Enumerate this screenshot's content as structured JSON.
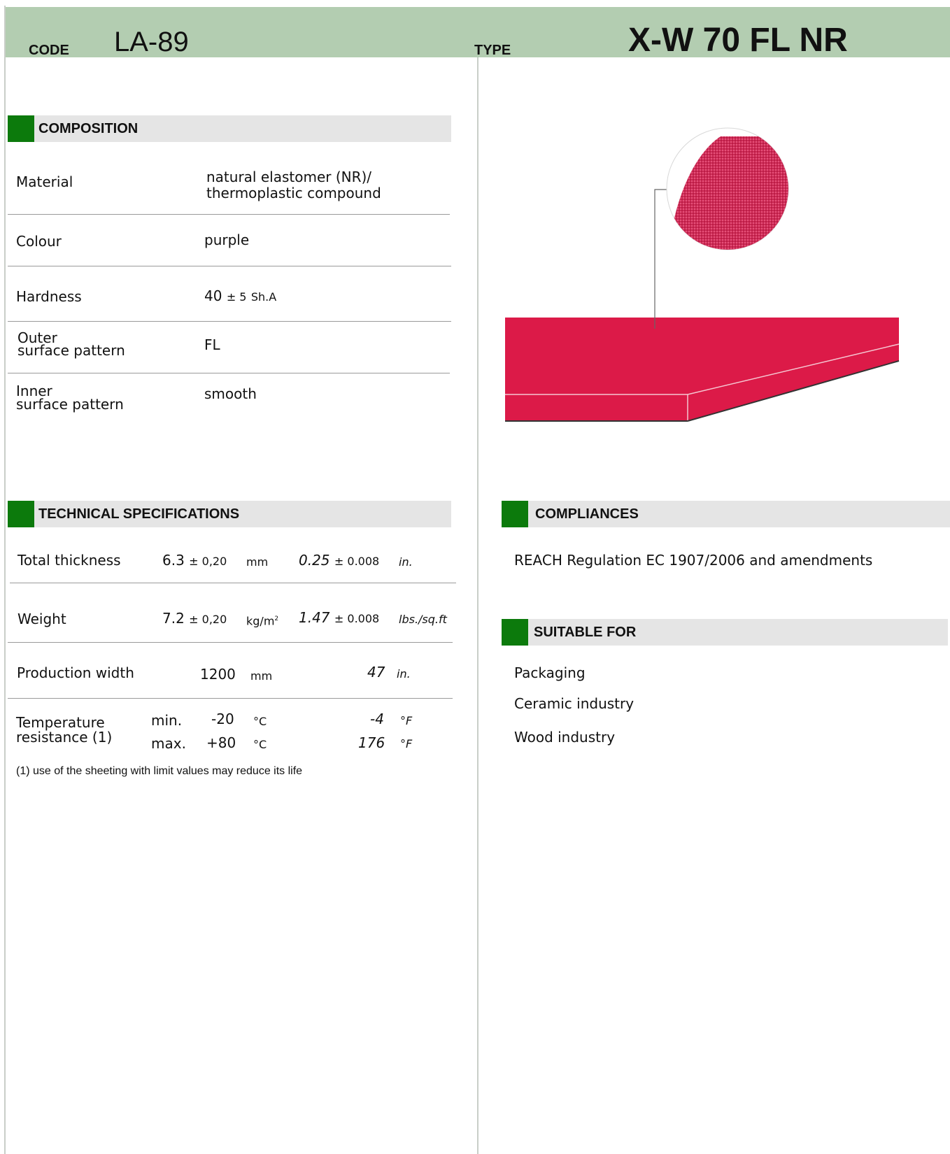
{
  "header": {
    "code_label": "CODE",
    "code_value": "LA-89",
    "type_label": "TYPE",
    "type_value": "X-W 70 FL NR"
  },
  "composition": {
    "title": "COMPOSITION",
    "rows": [
      {
        "label": "Material",
        "value_line1": "natural elastomer (NR)/",
        "value_line2": "thermoplastic compound"
      },
      {
        "label": "Colour",
        "value": "purple"
      },
      {
        "label": "Hardness",
        "value": "40",
        "tolerance": "± 5",
        "unit": "Sh.A"
      },
      {
        "label_line1": "Outer",
        "label_line2": "surface pattern",
        "value": "FL"
      },
      {
        "label_line1": "Inner",
        "label_line2": "surface pattern",
        "value": "smooth"
      }
    ]
  },
  "technical": {
    "title": "TECHNICAL SPECIFICATIONS",
    "thickness": {
      "label": "Total thickness",
      "value": "6.3",
      "tol": "± 0,20",
      "unit": "mm",
      "imp_value": "0.25",
      "imp_tol": "± 0.008",
      "imp_unit": "in."
    },
    "weight": {
      "label": "Weight",
      "value": "7.2",
      "tol": "± 0,20",
      "unit": "kg/m",
      "unit_sup": "2",
      "imp_value": "1.47",
      "imp_tol": "± 0.008",
      "imp_unit": "lbs./sq.ft"
    },
    "width": {
      "label": "Production width",
      "value": "1200",
      "unit": "mm",
      "imp_value": "47",
      "imp_unit": "in."
    },
    "temperature": {
      "label_line1": "Temperature",
      "label_line2": "resistance (1)",
      "min_label": "min.",
      "min_value": "-20",
      "min_unit": "°C",
      "min_imp": "-4",
      "min_imp_unit": "°F",
      "max_label": "max.",
      "max_value": "+80",
      "max_unit": "°C",
      "max_imp": "176",
      "max_imp_unit": "°F"
    },
    "footnote": "(1) use of the sheeting with limit values may reduce its life"
  },
  "compliances": {
    "title": "COMPLIANCES",
    "text": "REACH Regulation EC 1907/2006 and amendments"
  },
  "suitable": {
    "title": "SUITABLE FOR",
    "items": [
      "Packaging",
      "Ceramic industry",
      "Wood industry"
    ]
  },
  "colors": {
    "header_bg": "#b3cdb1",
    "accent_green": "#0c7a0c",
    "section_bg": "#e5e5e5",
    "belt_red": "#dc1a48"
  },
  "icons": {
    "belt_illustration": "belt-sheet-illustration",
    "surface_detail": "surface-texture-magnifier"
  }
}
